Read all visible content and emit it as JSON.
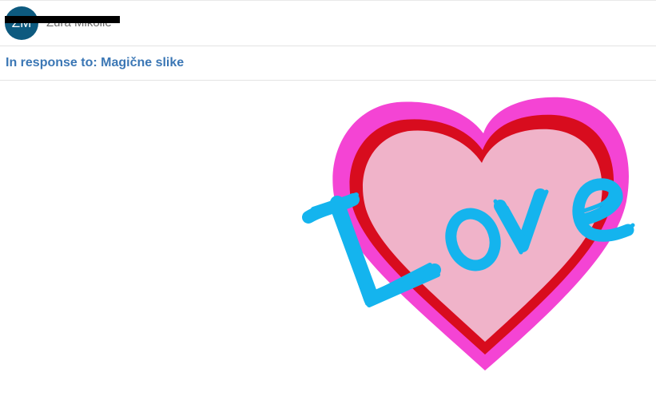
{
  "post": {
    "avatar_initials": "ZM",
    "author_name": "Zura Mikolle",
    "in_response_to": "In response to: Magične slike"
  },
  "image": {
    "subject": "heart-love-icon",
    "lettering": "Love",
    "colors": {
      "outer": "#f444d4",
      "middle": "#d80c1e",
      "inner": "#f0b3c9",
      "text": "#14b4ee"
    }
  },
  "colors": {
    "avatar_bg": "#0d5a7f",
    "link": "#3b77b5",
    "author": "#6b6b6b"
  }
}
